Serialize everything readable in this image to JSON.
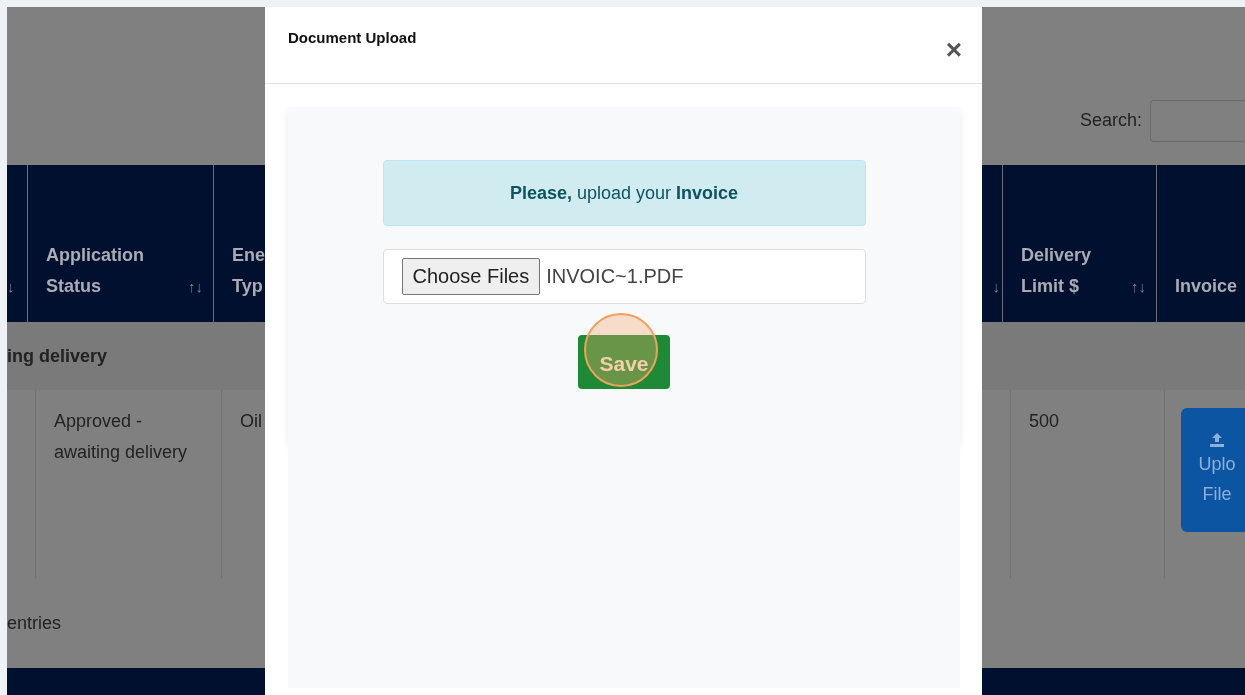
{
  "page": {
    "search": {
      "label": "Search:"
    },
    "left_columns": [
      {
        "sort": "↓"
      },
      {
        "label": "Application Status",
        "sort": "↑↓"
      },
      {
        "label": "Ene Typ"
      }
    ],
    "right_columns": [
      {
        "sort": "↓"
      },
      {
        "label": "Delivery Limit $",
        "sort": "↑↓"
      },
      {
        "label": "Invoice"
      }
    ],
    "group_row": "ing delivery",
    "left_cells": [
      "Approved - awaiting delivery",
      "Oil"
    ],
    "right_cells": [
      "500"
    ],
    "upload_button": [
      "Uplo",
      "File"
    ],
    "footer_text": "entries"
  },
  "modal": {
    "title": "Document Upload",
    "close": "×",
    "alert": "**Please,** upload your **Invoice**",
    "file_input": {
      "button": "Choose Files",
      "value": "INVOIC~1.PDF"
    },
    "save_button": "Save",
    "save_highlighted": true
  }
}
